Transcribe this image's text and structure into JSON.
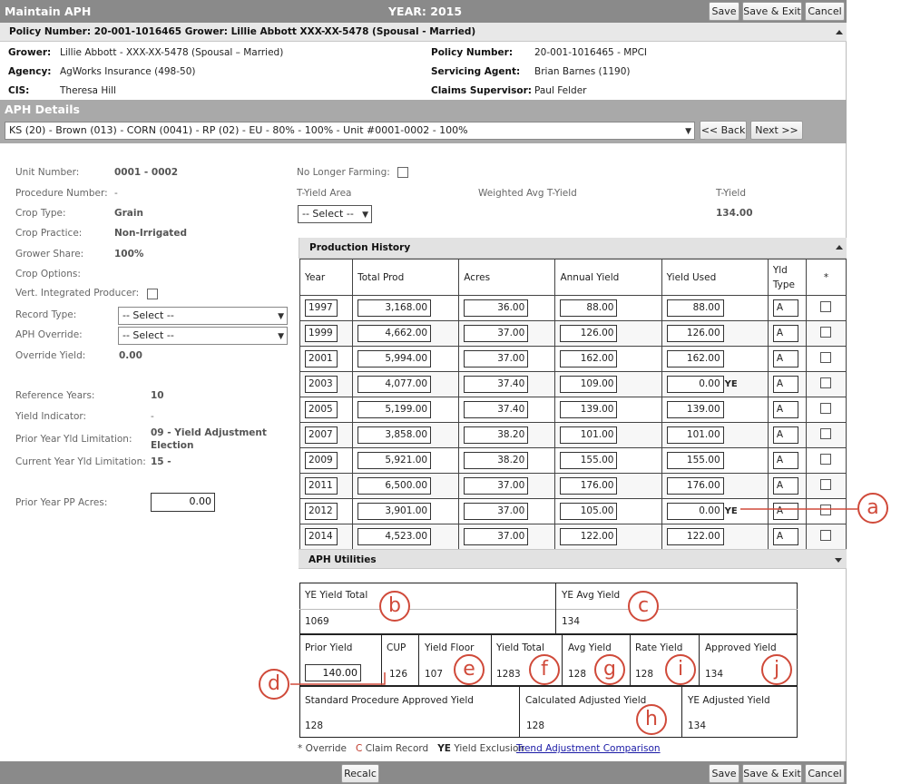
{
  "titlebar": {
    "app_title": "Maintain APH",
    "year": "YEAR: 2015",
    "save": "Save",
    "save_exit": "Save & Exit",
    "cancel": "Cancel"
  },
  "policy_header": "Policy Number: 20-001-1016465 Grower: Lillie Abbott XXX-XX-5478 (Spousal - Married)",
  "policy_info": {
    "grower_label": "Grower:",
    "grower": "Lillie Abbott - XXX-XX-5478 (Spousal – Married)",
    "agency_label": "Agency:",
    "agency": "AgWorks Insurance (498-50)",
    "cis_label": "CIS:",
    "cis": "Theresa Hill",
    "policy_number_label": "Policy Number:",
    "policy_number": "20-001-1016465 - MPCI",
    "servicing_agent_label": "Servicing Agent:",
    "servicing_agent": "Brian Barnes (1190)",
    "claims_supervisor_label": "Claims Supervisor:",
    "claims_supervisor": "Paul Felder"
  },
  "aph_details": {
    "title": "APH Details",
    "unit_select": "KS (20) - Brown (013) - CORN (0041) - RP (02) - EU - 80% - 100% - Unit #0001-0002 - 100%",
    "back": "<< Back",
    "next": "Next >>"
  },
  "left": {
    "unit_number_label": "Unit Number:",
    "unit_number": "0001 - 0002",
    "procedure_number_label": "Procedure Number:",
    "procedure_number": "-",
    "crop_type_label": "Crop Type:",
    "crop_type": "Grain",
    "crop_practice_label": "Crop Practice:",
    "crop_practice": "Non-Irrigated",
    "grower_share_label": "Grower Share:",
    "grower_share": "100%",
    "crop_options_label": "Crop Options:",
    "vert_label": "Vert. Integrated Producer:",
    "record_type_label": "Record Type:",
    "record_type": "-- Select --",
    "aph_override_label": "APH Override:",
    "aph_override": "-- Select --",
    "override_yield_label": "Override Yield:",
    "override_yield": "0.00",
    "reference_years_label": "Reference Years:",
    "reference_years": "10",
    "yield_indicator_label": "Yield Indicator:",
    "yield_indicator": "-",
    "prior_limitation_label": "Prior Year Yld Limitation:",
    "prior_limitation_1": "09 - Yield Adjustment",
    "prior_limitation_2": "Election",
    "current_limitation_label": "Current Year Yld Limitation:",
    "current_limitation": "15 -",
    "prior_pp_label": "Prior Year PP Acres:",
    "prior_pp": "0.00"
  },
  "right": {
    "no_longer_farming_label": "No Longer Farming:",
    "t_yield_area_label": "T-Yield Area",
    "t_yield_area": "-- Select --",
    "weighted_avg_label": "Weighted Avg T-Yield",
    "t_yield_label": "T-Yield",
    "t_yield": "134.00"
  },
  "production_history": {
    "title": "Production History",
    "headers": {
      "year": "Year",
      "total_prod": "Total Prod",
      "acres": "Acres",
      "annual_yield": "Annual Yield",
      "yield_used": "Yield Used",
      "yld_type_1": "Yld",
      "yld_type_2": "Type",
      "star": "*"
    },
    "rows": [
      {
        "year": "1997",
        "prod": "3,168.00",
        "acres": "36.00",
        "annual": "88.00",
        "used": "88.00",
        "flag": "",
        "type": "A"
      },
      {
        "year": "1999",
        "prod": "4,662.00",
        "acres": "37.00",
        "annual": "126.00",
        "used": "126.00",
        "flag": "",
        "type": "A"
      },
      {
        "year": "2001",
        "prod": "5,994.00",
        "acres": "37.00",
        "annual": "162.00",
        "used": "162.00",
        "flag": "",
        "type": "A"
      },
      {
        "year": "2003",
        "prod": "4,077.00",
        "acres": "37.40",
        "annual": "109.00",
        "used": "0.00",
        "flag": "YE",
        "type": "A"
      },
      {
        "year": "2005",
        "prod": "5,199.00",
        "acres": "37.40",
        "annual": "139.00",
        "used": "139.00",
        "flag": "",
        "type": "A"
      },
      {
        "year": "2007",
        "prod": "3,858.00",
        "acres": "38.20",
        "annual": "101.00",
        "used": "101.00",
        "flag": "",
        "type": "A"
      },
      {
        "year": "2009",
        "prod": "5,921.00",
        "acres": "38.20",
        "annual": "155.00",
        "used": "155.00",
        "flag": "",
        "type": "A"
      },
      {
        "year": "2011",
        "prod": "6,500.00",
        "acres": "37.00",
        "annual": "176.00",
        "used": "176.00",
        "flag": "",
        "type": "A"
      },
      {
        "year": "2012",
        "prod": "3,901.00",
        "acres": "37.00",
        "annual": "105.00",
        "used": "0.00",
        "flag": "YE",
        "type": "A"
      },
      {
        "year": "2014",
        "prod": "4,523.00",
        "acres": "37.00",
        "annual": "122.00",
        "used": "122.00",
        "flag": "",
        "type": "A"
      }
    ]
  },
  "aph_utilities": {
    "title": "APH Utilities"
  },
  "summary": {
    "ye_yield_total_label": "YE Yield Total",
    "ye_yield_total": "1069",
    "ye_avg_yield_label": "YE Avg Yield",
    "ye_avg_yield": "134",
    "prior_yield_label": "Prior Yield",
    "prior_yield": "140.00",
    "cup_label": "CUP",
    "cup": "126",
    "yield_floor_label": "Yield Floor",
    "yield_floor": "107",
    "yield_total_label": "Yield Total",
    "yield_total": "1283",
    "avg_yield_label": "Avg Yield",
    "avg_yield": "128",
    "rate_yield_label": "Rate Yield",
    "rate_yield": "128",
    "approved_yield_label": "Approved Yield",
    "approved_yield": "134",
    "std_proc_label": "Standard Procedure Approved Yield",
    "std_proc": "128",
    "calc_adj_label": "Calculated Adjusted Yield",
    "calc_adj": "128",
    "ye_adj_label": "YE Adjusted Yield",
    "ye_adj": "134"
  },
  "legend": {
    "override": "* Override",
    "c": "C",
    "claim": "Claim Record",
    "ye": "YE",
    "ye_text": "Yield Exclusion",
    "trend_link": "Trend Adjustment Comparison"
  },
  "bottombar": {
    "recalc": "Recalc",
    "save": "Save",
    "save_exit": "Save & Exit",
    "cancel": "Cancel"
  },
  "callouts": {
    "a": "a",
    "b": "b",
    "c": "c",
    "d": "d",
    "e": "e",
    "f": "f",
    "g": "g",
    "h": "h",
    "i": "i",
    "j": "j"
  },
  "colors": {
    "callout": "#d04a3a",
    "titlebar": "#8a8a8a",
    "aph_bar": "#a9a9a9",
    "link": "#1a1aa6"
  }
}
